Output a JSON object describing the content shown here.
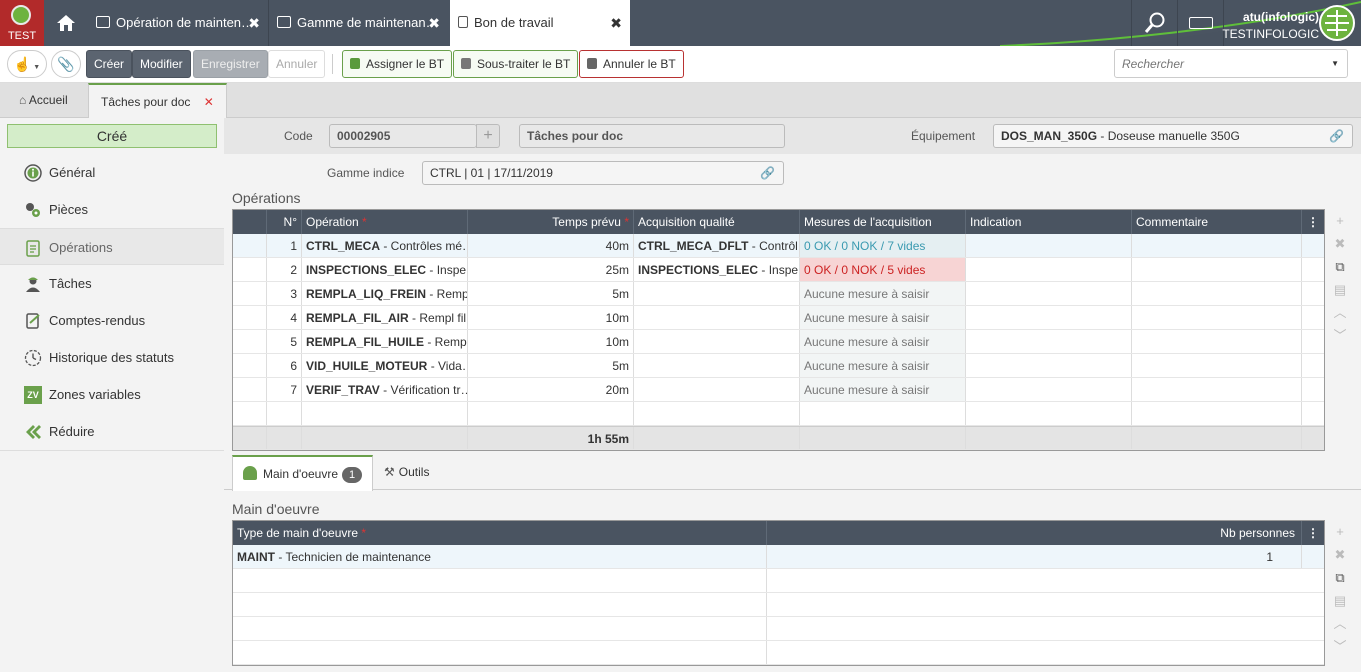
{
  "app": {
    "env_label": "TEST"
  },
  "window_tabs": [
    {
      "label": "Opération de mainten…",
      "active": false
    },
    {
      "label": "Gamme de maintenan…",
      "active": false
    },
    {
      "label": "Bon de travail",
      "active": true
    }
  ],
  "user": {
    "name": "atu(infologic)",
    "company": "TESTINFOLOGIC"
  },
  "toolbar": {
    "create": "Créer",
    "modify": "Modifier",
    "save": "Enregistrer",
    "cancel": "Annuler",
    "assign": "Assigner le BT",
    "subcontract": "Sous-traiter le BT",
    "cancel_bt": "Annuler le BT",
    "search_placeholder": "Rechercher"
  },
  "doc_tabs": [
    {
      "label": "Accueil",
      "active": false
    },
    {
      "label": "Tâches pour doc",
      "active": true
    }
  ],
  "status": "Créé",
  "sidebar": {
    "items": [
      {
        "label": "Général",
        "icon": "info-icon"
      },
      {
        "label": "Pièces",
        "icon": "parts-icon"
      },
      {
        "label": "Opérations",
        "icon": "clipboard-icon",
        "active": true
      },
      {
        "label": "Tâches",
        "icon": "worker-icon"
      },
      {
        "label": "Comptes-rendus",
        "icon": "report-icon"
      },
      {
        "label": "Historique des statuts",
        "icon": "clock-icon"
      },
      {
        "label": "Zones variables",
        "icon": "zv-icon",
        "badge": "ZV"
      },
      {
        "label": "Réduire",
        "icon": "chevrons-left-icon"
      }
    ]
  },
  "form": {
    "code_label": "Code",
    "code_value": "00002905",
    "title_value": "Tâches pour doc",
    "equipment_label": "Équipement",
    "equipment_code": "DOS_MAN_350G",
    "equipment_desc": " - Doseuse manuelle 350G",
    "gamme_label": "Gamme indice",
    "gamme_value": "CTRL | 01 | 17/11/2019"
  },
  "operations": {
    "title": "Opérations",
    "columns": {
      "num": "N°",
      "operation": "Opération",
      "temps": "Temps prévu",
      "acquisition": "Acquisition qualité",
      "mesures": "Mesures de l'acquisition",
      "indication": "Indication",
      "commentaire": "Commentaire"
    },
    "rows": [
      {
        "num": "1",
        "op_code": "CTRL_MECA",
        "op_desc": " - Contrôles mé…",
        "temps": "40m",
        "acq_code": "CTRL_MECA_DFLT",
        "acq_desc": " - Contrôl…",
        "mesures": "0 OK / 0 NOK / 7 vides",
        "mesure_state": "ok"
      },
      {
        "num": "2",
        "op_code": "INSPECTIONS_ELEC",
        "op_desc": " - Inspe…",
        "temps": "25m",
        "acq_code": "INSPECTIONS_ELEC",
        "acq_desc": " - Inspe…",
        "mesures": "0 OK / 0 NOK / 5 vides",
        "mesure_state": "nok"
      },
      {
        "num": "3",
        "op_code": "REMPLA_LIQ_FREIN",
        "op_desc": " - Remp…",
        "temps": "5m",
        "acq_code": "",
        "acq_desc": "",
        "mesures": "Aucune mesure à saisir",
        "mesure_state": "none"
      },
      {
        "num": "4",
        "op_code": "REMPLA_FIL_AIR",
        "op_desc": " - Rempl fil…",
        "temps": "10m",
        "acq_code": "",
        "acq_desc": "",
        "mesures": "Aucune mesure à saisir",
        "mesure_state": "none"
      },
      {
        "num": "5",
        "op_code": "REMPLA_FIL_HUILE",
        "op_desc": " - Remp…",
        "temps": "10m",
        "acq_code": "",
        "acq_desc": "",
        "mesures": "Aucune mesure à saisir",
        "mesure_state": "none"
      },
      {
        "num": "6",
        "op_code": "VID_HUILE_MOTEUR",
        "op_desc": " - Vida…",
        "temps": "5m",
        "acq_code": "",
        "acq_desc": "",
        "mesures": "Aucune mesure à saisir",
        "mesure_state": "none"
      },
      {
        "num": "7",
        "op_code": "VERIF_TRAV",
        "op_desc": " - Vérification tr…",
        "temps": "20m",
        "acq_code": "",
        "acq_desc": "",
        "mesures": "Aucune mesure à saisir",
        "mesure_state": "none"
      }
    ],
    "total": "1h 55m"
  },
  "subtabs": [
    {
      "label": "Main d'oeuvre",
      "count": "1",
      "active": true
    },
    {
      "label": "Outils",
      "active": false
    }
  ],
  "labor": {
    "title": "Main d'oeuvre",
    "columns": {
      "type": "Type de main d'oeuvre",
      "nb": "Nb personnes"
    },
    "rows": [
      {
        "code": "MAINT",
        "desc": " - Technicien de maintenance",
        "nb": "1"
      }
    ]
  }
}
